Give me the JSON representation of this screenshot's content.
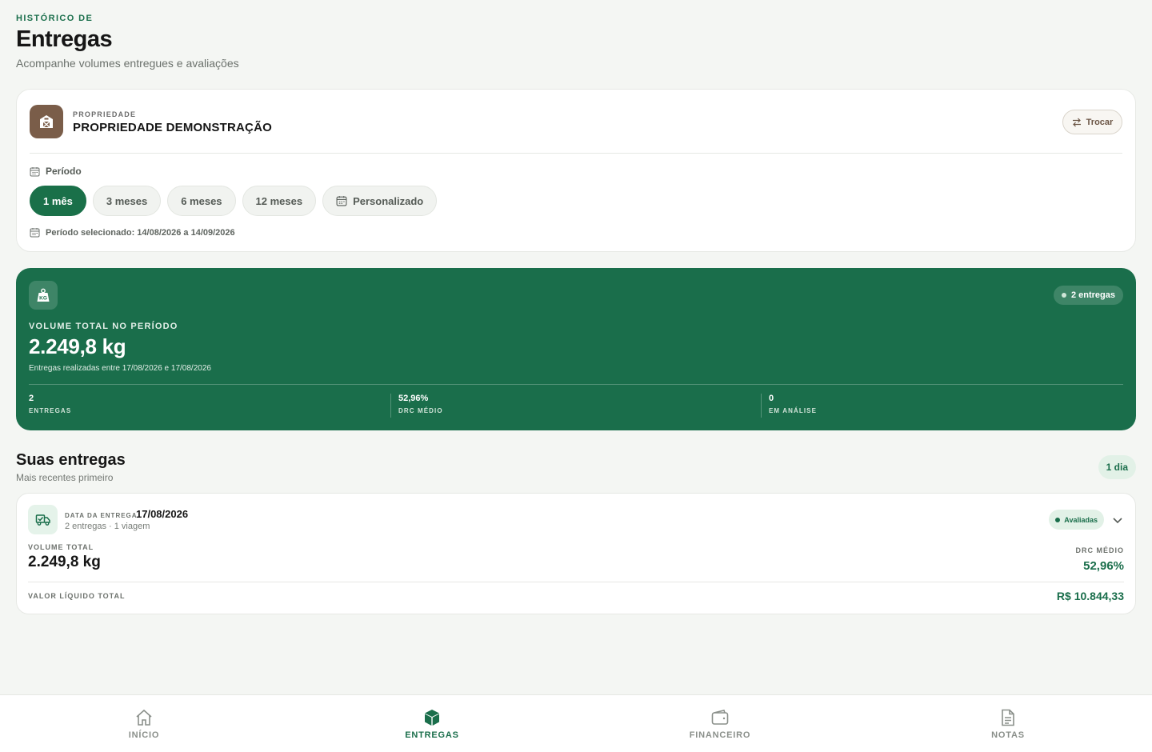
{
  "header": {
    "eyebrow": "HISTÓRICO DE",
    "title": "Entregas",
    "subtitle": "Acompanhe volumes entregues e avaliações"
  },
  "property": {
    "eyebrow": "PROPRIEDADE",
    "name": "PROPRIEDADE DEMONSTRAÇÃO",
    "swap_label": "Trocar",
    "period_label": "Período",
    "chips": [
      {
        "label": "1 mês",
        "active": true
      },
      {
        "label": "3 meses",
        "active": false
      },
      {
        "label": "6 meses",
        "active": false
      },
      {
        "label": "12 meses",
        "active": false
      },
      {
        "label": "Personalizado",
        "active": false
      }
    ],
    "selected_range": "Período selecionado: 14/08/2026 a 14/09/2026"
  },
  "volume": {
    "count_pill": "2 entregas",
    "eyebrow": "VOLUME TOTAL NO PERÍODO",
    "value": "2.249,8 kg",
    "range": "Entregas realizadas entre 17/08/2026 e 17/08/2026",
    "stats": [
      {
        "value": "2",
        "label": "ENTREGAS"
      },
      {
        "value": "52,96%",
        "label": "DRC MÉDIO"
      },
      {
        "value": "0",
        "label": "EM ANÁLISE"
      }
    ]
  },
  "deliveries": {
    "title": "Suas entregas",
    "subtitle": "Mais recentes primeiro",
    "day_pill": "1 dia",
    "items": [
      {
        "date_label": "DATA DA ENTREGA",
        "date": "17/08/2026",
        "meta": "2 entregas · 1 viagem",
        "status": "Avaliadas",
        "volume_label": "VOLUME TOTAL",
        "volume": "2.249,8 kg",
        "drc_label": "DRC MÉDIO",
        "drc": "52,96%",
        "net_label": "VALOR LÍQUIDO TOTAL",
        "net": "R$ 10.844,33"
      }
    ]
  },
  "nav": [
    {
      "label": "INÍCIO",
      "icon": "home-icon",
      "active": false
    },
    {
      "label": "ENTREGAS",
      "icon": "box-icon",
      "active": true
    },
    {
      "label": "FINANCEIRO",
      "icon": "wallet-icon",
      "active": false
    },
    {
      "label": "NOTAS",
      "icon": "document-icon",
      "active": false
    }
  ],
  "colors": {
    "brand_green": "#1a6e4b",
    "property_brown": "#7a5d49",
    "background": "#f4f6f3"
  }
}
